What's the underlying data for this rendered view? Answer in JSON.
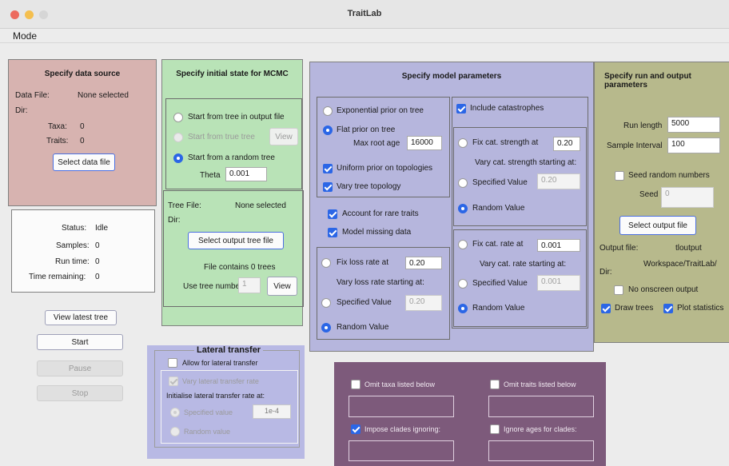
{
  "window": {
    "title": "TraitLab"
  },
  "menu": {
    "mode": "Mode"
  },
  "data_source": {
    "title": "Specify data source",
    "data_file_label": "Data File:",
    "data_file_value": "None selected",
    "dir_label": "Dir:",
    "taxa_label": "Taxa:",
    "taxa_value": "0",
    "traits_label": "Traits:",
    "traits_value": "0",
    "select_button": "Select data file"
  },
  "status": {
    "status_label": "Status:",
    "status_value": "Idle",
    "samples_label": "Samples:",
    "samples_value": "0",
    "runtime_label": "Run time:",
    "runtime_value": "0",
    "remaining_label": "Time remaining:",
    "remaining_value": "0"
  },
  "controls": {
    "view_latest": "View latest tree",
    "start": "Start",
    "pause": "Pause",
    "stop": "Stop"
  },
  "initial_state": {
    "title": "Specify initial state for MCMC",
    "from_output": "Start from tree in output file",
    "from_true": "Start from true tree",
    "view1": "View",
    "from_random": "Start from a random tree",
    "theta_label": "Theta",
    "theta_value": "0.001",
    "tree_file_label": "Tree File:",
    "tree_file_value": "None selected",
    "dir_label": "Dir:",
    "select_output_tree": "Select output tree file",
    "contains": "File contains 0 trees",
    "use_tree_number": "Use tree number",
    "tree_number": "1",
    "view2": "View"
  },
  "model": {
    "title": "Specify model parameters",
    "exp_prior": "Exponential prior on tree",
    "flat_prior": "Flat prior on tree",
    "max_root_age_label": "Max root age",
    "max_root_age_value": "16000",
    "uniform_prior": "Uniform prior on topologies",
    "vary_topology": "Vary tree topology",
    "rare_traits": "Account for rare traits",
    "missing_data": "Model missing data",
    "fix_loss": "Fix loss rate at",
    "fix_loss_value": "0.20",
    "vary_loss": "Vary loss rate starting at:",
    "specified_value": "Specified Value",
    "specified_loss_value": "0.20",
    "random_value": "Random Value",
    "include_cat": "Include catastrophes",
    "fix_cat_strength": "Fix cat. strength at",
    "fix_cat_strength_value": "0.20",
    "vary_cat_strength": "Vary cat. strength starting at:",
    "specified_strength_value": "0.20",
    "fix_cat_rate": "Fix cat. rate at",
    "fix_cat_rate_value": "0.001",
    "vary_cat_rate": "Vary cat. rate starting at:",
    "specified_rate_value": "0.001"
  },
  "run": {
    "title": "Specify run and output parameters",
    "run_length_label": "Run length",
    "run_length_value": "5000",
    "sample_interval_label": "Sample Interval",
    "sample_interval_value": "100",
    "seed_random": "Seed random numbers",
    "seed_label": "Seed",
    "seed_value": "0",
    "select_output": "Select output file",
    "output_file_label": "Output file:",
    "output_file_value": "tloutput",
    "dir_value": "Workspace/TraitLab/",
    "dir_label": "Dir:",
    "no_onscreen": "No onscreen output",
    "draw_trees": "Draw trees",
    "plot_stats": "Plot statistics"
  },
  "lateral": {
    "title": "Lateral transfer",
    "allow": "Allow for lateral transfer",
    "vary_rate": "Vary lateral transfer rate",
    "init_label": "Initialise lateral transfer rate at:",
    "specified": "Specified value",
    "specified_value": "1e-4",
    "random": "Random value"
  },
  "clades": {
    "omit_taxa": "Omit taxa listed below",
    "omit_traits": "Omit traits listed below",
    "impose": "Impose clades ignoring:",
    "ignore_ages": "Ignore ages for clades:"
  },
  "colors": {
    "data_source": "#d7b3b0",
    "initial_state": "#b9e3b7",
    "model": "#b6b6dd",
    "run": "#b7b98c",
    "clades": "#7d5a7b",
    "lateral": "#b8b9e4"
  }
}
